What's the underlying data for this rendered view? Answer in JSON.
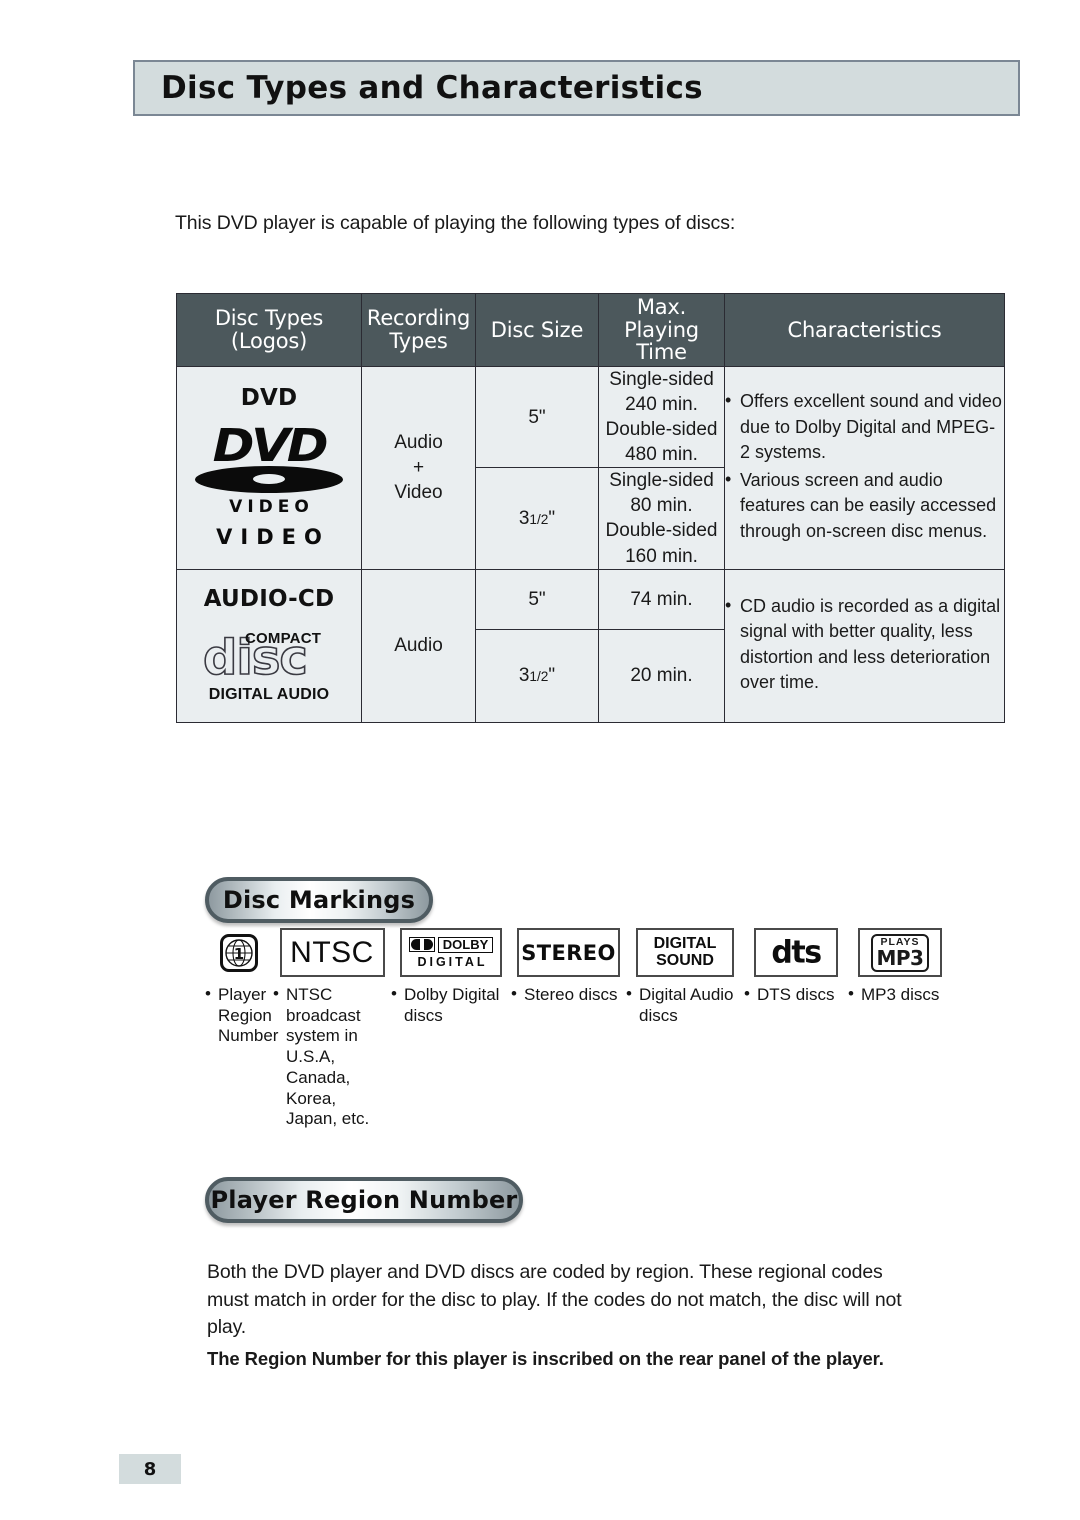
{
  "page": {
    "title": "Disc Types and Characteristics",
    "number": "8"
  },
  "intro": "This DVD player is capable of playing the following types of discs:",
  "table": {
    "headers": {
      "col1_line1": "Disc Types",
      "col1_line2": "(Logos)",
      "col2_line1": "Recording",
      "col2_line2": "Types",
      "col3": "Disc Size",
      "col4_line1": "Max.",
      "col4_line2": "Playing Time",
      "col5": "Characteristics"
    },
    "rows": [
      {
        "disc_label": "DVD",
        "logo": {
          "word": "DVD",
          "video_small": "VIDEO",
          "video_big": "VIDEO"
        },
        "recording_type_lines": [
          "Audio",
          "+",
          "Video"
        ],
        "sizes": [
          {
            "size_number": "5",
            "size_unit": "\"",
            "size_fraction": "",
            "time_lines": [
              "Single-sided",
              "240 min.",
              "Double-sided",
              "480 min."
            ]
          },
          {
            "size_number": "3",
            "size_unit": "\"",
            "size_fraction": "1/2",
            "time_lines": [
              "Single-sided",
              "80 min.",
              "Double-sided",
              "160 min."
            ]
          }
        ],
        "characteristics": [
          "Offers excellent sound and video due to Dolby Digital and MPEG-2 systems.",
          "Various screen and audio features can be easily accessed through on-screen disc menus."
        ]
      },
      {
        "disc_label": "AUDIO-CD",
        "logo": {
          "compact": "COMPACT",
          "disc_word": "disc",
          "digital_audio": "DIGITAL AUDIO"
        },
        "recording_type_lines": [
          "Audio"
        ],
        "sizes": [
          {
            "size_number": "5",
            "size_unit": "\"",
            "size_fraction": "",
            "time_lines": [
              "74 min."
            ]
          },
          {
            "size_number": "3",
            "size_unit": "\"",
            "size_fraction": "1/2",
            "time_lines": [
              "20 min."
            ]
          }
        ],
        "characteristics": [
          "CD audio is recorded as a digital signal with better quality, less distortion and less deterioration over time."
        ]
      }
    ]
  },
  "disc_markings": {
    "heading": "Disc Markings",
    "items": [
      {
        "icon": "region-globe-icon",
        "region_digit": "1",
        "caption": "Player Region Number"
      },
      {
        "icon": "ntsc-logo",
        "label": "NTSC",
        "caption": "NTSC broadcast system in U.S.A, Canada, Korea, Japan, etc."
      },
      {
        "icon": "dolby-digital-logo",
        "label_top": "DOLBY",
        "label_bottom": "DIGITAL",
        "caption": "Dolby Digital discs"
      },
      {
        "icon": "stereo-logo",
        "label": "STEREO",
        "caption": "Stereo discs"
      },
      {
        "icon": "digital-sound-logo",
        "label_top": "DIGITAL",
        "label_bottom": "SOUND",
        "caption": "Digital Audio discs"
      },
      {
        "icon": "dts-logo",
        "label": "dts",
        "caption": "DTS discs"
      },
      {
        "icon": "mp3-logo",
        "label_top": "PLAYS",
        "label_bottom": "MP3",
        "caption": "MP3 discs"
      }
    ]
  },
  "region_number": {
    "heading": "Player Region Number",
    "paragraph": "Both the DVD player and DVD discs are coded by region. These regional codes must match in order for the disc to play. If the codes do not match, the disc will not play.",
    "bold_note": "The Region Number for this player is inscribed on the rear panel of the player."
  },
  "colors": {
    "banner_bg": "#d3dcdd",
    "banner_border": "#7b8794",
    "table_header_bg": "#4c585c",
    "table_cell_bg": "#eaeef0",
    "pill_border": "#4f5c62"
  }
}
